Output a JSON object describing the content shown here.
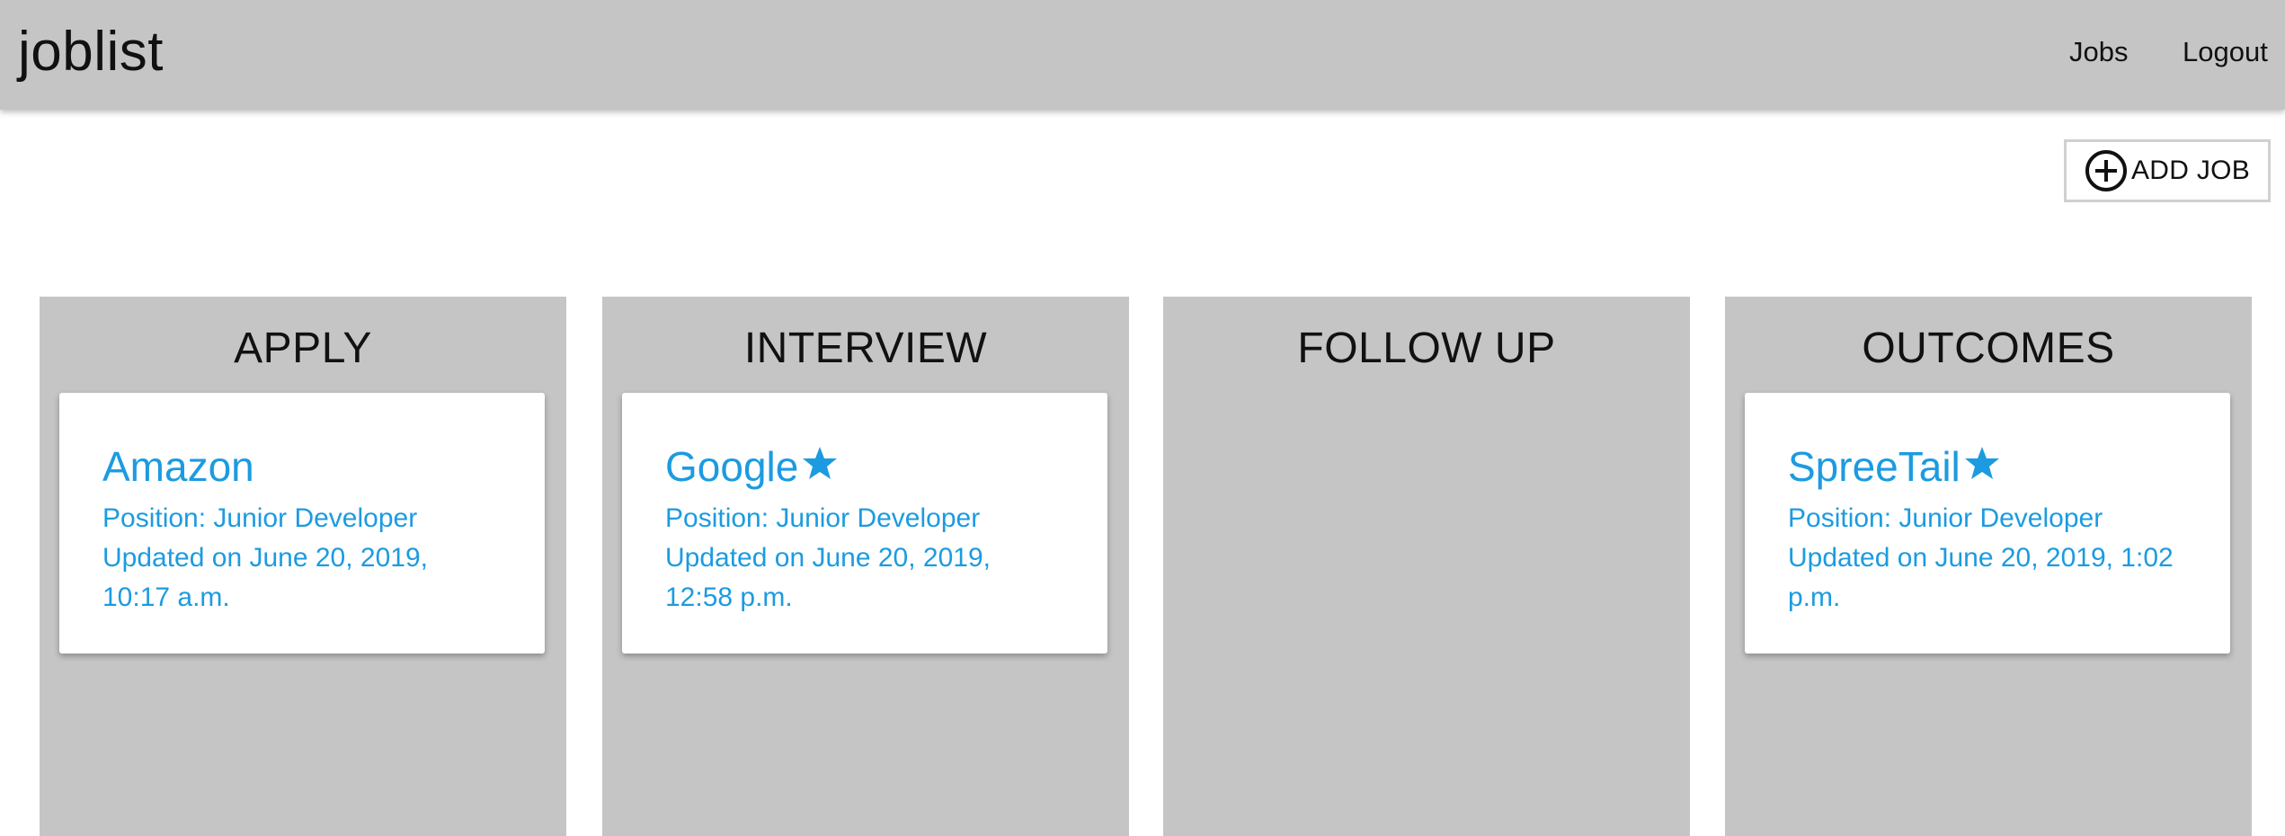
{
  "navbar": {
    "brand": "joblist",
    "links": [
      {
        "label": "Jobs"
      },
      {
        "label": "Logout"
      }
    ]
  },
  "toolbar": {
    "add_job_label": "ADD JOB",
    "add_job_icon": "plus-circle-icon"
  },
  "colors": {
    "navbar_bg": "#c5c5c5",
    "column_bg": "#c5c5c5",
    "accent": "#1c9be0"
  },
  "board": {
    "columns": [
      {
        "title": "APPLY",
        "cards": [
          {
            "company": "Amazon",
            "starred": false,
            "position": "Position: Junior Developer",
            "updated": "Updated on June 20, 2019, 10:17 a.m."
          }
        ]
      },
      {
        "title": "INTERVIEW",
        "cards": [
          {
            "company": "Google",
            "starred": true,
            "position": "Position: Junior Developer",
            "updated": "Updated on June 20, 2019, 12:58 p.m."
          }
        ]
      },
      {
        "title": "FOLLOW UP",
        "cards": []
      },
      {
        "title": "OUTCOMES",
        "cards": [
          {
            "company": "SpreeTail",
            "starred": true,
            "position": "Position: Junior Developer",
            "updated": "Updated on June 20, 2019, 1:02 p.m."
          }
        ]
      }
    ]
  }
}
